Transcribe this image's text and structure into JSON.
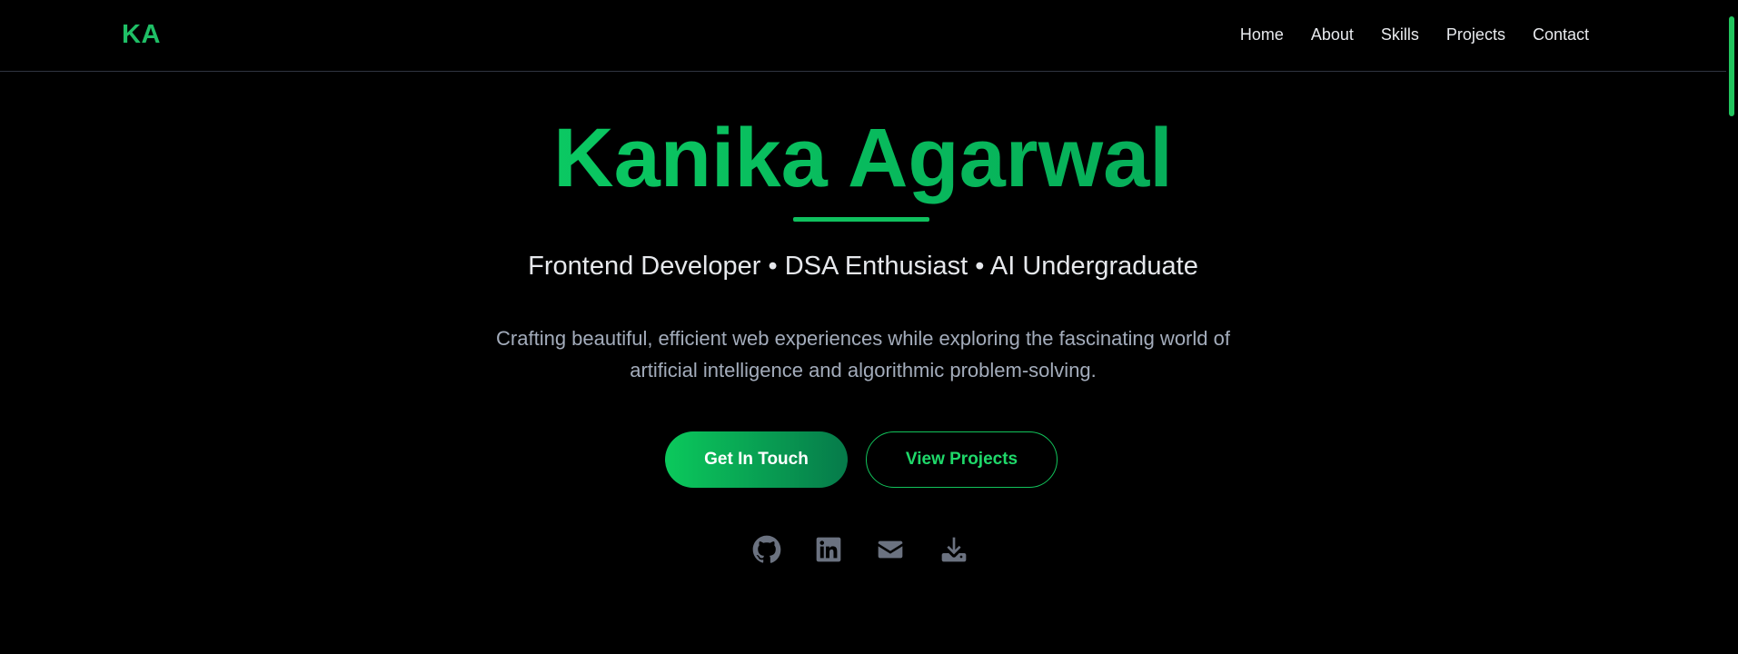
{
  "navbar": {
    "logo": "KA",
    "links": [
      "Home",
      "About",
      "Skills",
      "Projects",
      "Contact"
    ]
  },
  "hero": {
    "name": "Kanika Agarwal",
    "subtitle": "Frontend Developer • DSA Enthusiast • AI Undergraduate",
    "description": "Crafting beautiful, efficient web experiences while exploring the fascinating world of artificial intelligence and algorithmic problem-solving.",
    "primary_button": "Get In Touch",
    "secondary_button": "View Projects"
  },
  "social_icons": [
    "github-icon",
    "linkedin-icon",
    "email-icon",
    "download-icon"
  ],
  "colors": {
    "background": "#000000",
    "accent": "#1fbf66",
    "accent_bright": "#0fe06b",
    "text_primary": "#e6e8ec",
    "text_muted": "#a3acbb",
    "icon_gray": "#6b7280"
  }
}
